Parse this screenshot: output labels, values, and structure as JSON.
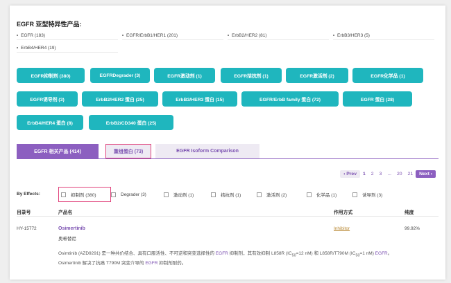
{
  "section": {
    "title": "EGFR 亚型特异性产品:"
  },
  "subtypes": [
    "EGFR (183)",
    "EGFR/ErbB1/HER1 (201)",
    "ErbB2/HER2 (81)",
    "ErbB3/HER3 (5)",
    "ErbB4/HER4 (19)"
  ],
  "categories": [
    "EGFR抑制剂 (380)",
    "EGFRDegrader (3)",
    "EGFR激动剂 (1)",
    "EGFR拮抗剂 (1)",
    "EGFR激活剂 (2)",
    "EGFR化学品 (1)",
    "EGFR诱导剂 (3)",
    "ErbB2/HER2 蛋白 (25)",
    "ErbB3/HER3 蛋白 (15)",
    "EGFR/ErbB family 蛋白 (72)",
    "EGFR 蛋白 (28)",
    "ErbB4/HER4 蛋白 (8)",
    "ErbB2/CD340 蛋白 (25)"
  ],
  "tabs": [
    "EGFR 相关产品 (414)",
    "重组蛋白 (73)",
    "EGFR Isoform Comparison"
  ],
  "pagination": {
    "prev": "‹ Prev",
    "pages": [
      "1",
      "2",
      "3",
      "...",
      "20",
      "21"
    ],
    "next": "Next ›"
  },
  "effects": {
    "label": "By Effects:",
    "filters": [
      "抑制剂 (380)",
      "Degrader (3)",
      "激动剂 (1)",
      "拮抗剂 (1)",
      "激活剂 (2)",
      "化学品 (1)",
      "诱导剂 (3)"
    ]
  },
  "table": {
    "headers": {
      "catalog": "目录号",
      "name": "产品名",
      "action": "作用方式",
      "purity": "纯度"
    },
    "row": {
      "catalog": "HY-15772",
      "name": "Osimertinib",
      "name_cn": "奥希替尼",
      "action": "Inhibitor",
      "purity": "99.92%",
      "description_line1_a": "Osimtinib (AZD9291) 是一种共价结合、具有口服活性、不可逆和突变选择性的 ",
      "description_line1_link": "EGFR",
      "description_line1_b": " 抑制剂，其有效抑制 L858R (IC",
      "description_line1_sub1": "50",
      "description_line1_c": "=12 nM) 和 L858R/T790M (IC",
      "description_line1_sub2": "50",
      "description_line1_d": "=1 nM) ",
      "description_line1_link2": "EGFR",
      "description_line1_e": "。",
      "description_line2_a": "Osimertinib 解决了抗癌 T790M 突变介导的 ",
      "description_line2_link": "EGFR",
      "description_line2_b": " 抑制剂耐药。"
    }
  },
  "colors": {
    "teal": "#1fb6be",
    "purple": "#8c5fc0",
    "highlight": "#e0407a",
    "link": "#7a4fb0"
  }
}
